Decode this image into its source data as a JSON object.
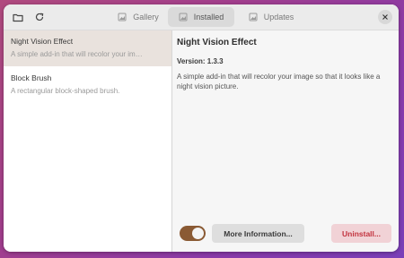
{
  "header": {
    "tabs": [
      {
        "label": "Gallery",
        "icon": "gallery-icon"
      },
      {
        "label": "Installed",
        "icon": "installed-icon"
      },
      {
        "label": "Updates",
        "icon": "updates-icon"
      }
    ],
    "active_tab": "Installed"
  },
  "addins": [
    {
      "name": "Night Vision Effect",
      "description": "A simple add-in that will recolor your im…",
      "selected": true
    },
    {
      "name": "Block Brush",
      "description": "A rectangular block-shaped brush.",
      "selected": false
    }
  ],
  "detail": {
    "title": "Night Vision Effect",
    "version": "Version: 1.3.3",
    "description": "A simple add-in that will recolor your image so that it looks like a night vision picture.",
    "enabled": true,
    "more_info_label": "More Information...",
    "uninstall_label": "Uninstall..."
  },
  "colors": {
    "accent": "#8a5a34",
    "destructive_text": "#c2323e",
    "destructive_bg": "#f1d2d6",
    "selected_row": "#e9e2dd"
  }
}
